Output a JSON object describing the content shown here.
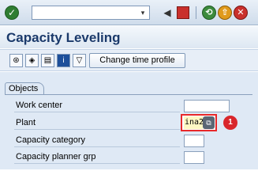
{
  "toolbar": {
    "enter_icon": "✓",
    "command_value": "",
    "dropdown_icon": "▾",
    "back_icon": "◀",
    "save_icon": "💾",
    "exit_icon": "↶",
    "cancel_icon": "✕"
  },
  "page": {
    "title": "Capacity Leveling"
  },
  "app_toolbar": {
    "change_time_profile": "Change time profile"
  },
  "objects": {
    "group_title": "Objects",
    "fields": [
      {
        "label": "Work center",
        "value": ""
      },
      {
        "label": "Plant",
        "value": "ina2"
      },
      {
        "label": "Capacity category",
        "value": ""
      },
      {
        "label": "Capacity planner grp",
        "value": ""
      }
    ]
  },
  "annotation": {
    "callout_number": "1"
  },
  "colors": {
    "title": "#1b3a6b",
    "highlight": "#e8282a",
    "callout": "#d9262b"
  }
}
